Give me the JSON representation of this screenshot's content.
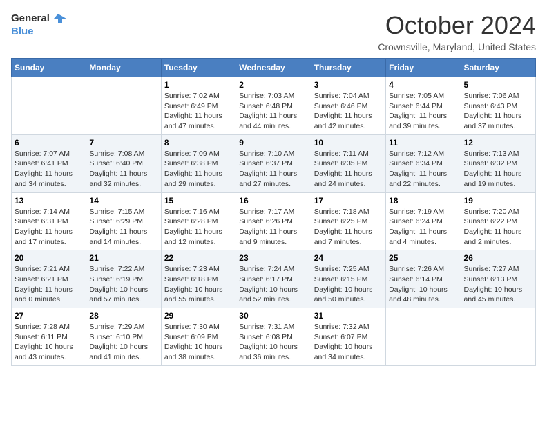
{
  "header": {
    "logo_line1": "General",
    "logo_line2": "Blue",
    "month_title": "October 2024",
    "location": "Crownsville, Maryland, United States"
  },
  "days_of_week": [
    "Sunday",
    "Monday",
    "Tuesday",
    "Wednesday",
    "Thursday",
    "Friday",
    "Saturday"
  ],
  "weeks": [
    [
      {
        "day": "",
        "sunrise": "",
        "sunset": "",
        "daylight": ""
      },
      {
        "day": "",
        "sunrise": "",
        "sunset": "",
        "daylight": ""
      },
      {
        "day": "1",
        "sunrise": "Sunrise: 7:02 AM",
        "sunset": "Sunset: 6:49 PM",
        "daylight": "Daylight: 11 hours and 47 minutes."
      },
      {
        "day": "2",
        "sunrise": "Sunrise: 7:03 AM",
        "sunset": "Sunset: 6:48 PM",
        "daylight": "Daylight: 11 hours and 44 minutes."
      },
      {
        "day": "3",
        "sunrise": "Sunrise: 7:04 AM",
        "sunset": "Sunset: 6:46 PM",
        "daylight": "Daylight: 11 hours and 42 minutes."
      },
      {
        "day": "4",
        "sunrise": "Sunrise: 7:05 AM",
        "sunset": "Sunset: 6:44 PM",
        "daylight": "Daylight: 11 hours and 39 minutes."
      },
      {
        "day": "5",
        "sunrise": "Sunrise: 7:06 AM",
        "sunset": "Sunset: 6:43 PM",
        "daylight": "Daylight: 11 hours and 37 minutes."
      }
    ],
    [
      {
        "day": "6",
        "sunrise": "Sunrise: 7:07 AM",
        "sunset": "Sunset: 6:41 PM",
        "daylight": "Daylight: 11 hours and 34 minutes."
      },
      {
        "day": "7",
        "sunrise": "Sunrise: 7:08 AM",
        "sunset": "Sunset: 6:40 PM",
        "daylight": "Daylight: 11 hours and 32 minutes."
      },
      {
        "day": "8",
        "sunrise": "Sunrise: 7:09 AM",
        "sunset": "Sunset: 6:38 PM",
        "daylight": "Daylight: 11 hours and 29 minutes."
      },
      {
        "day": "9",
        "sunrise": "Sunrise: 7:10 AM",
        "sunset": "Sunset: 6:37 PM",
        "daylight": "Daylight: 11 hours and 27 minutes."
      },
      {
        "day": "10",
        "sunrise": "Sunrise: 7:11 AM",
        "sunset": "Sunset: 6:35 PM",
        "daylight": "Daylight: 11 hours and 24 minutes."
      },
      {
        "day": "11",
        "sunrise": "Sunrise: 7:12 AM",
        "sunset": "Sunset: 6:34 PM",
        "daylight": "Daylight: 11 hours and 22 minutes."
      },
      {
        "day": "12",
        "sunrise": "Sunrise: 7:13 AM",
        "sunset": "Sunset: 6:32 PM",
        "daylight": "Daylight: 11 hours and 19 minutes."
      }
    ],
    [
      {
        "day": "13",
        "sunrise": "Sunrise: 7:14 AM",
        "sunset": "Sunset: 6:31 PM",
        "daylight": "Daylight: 11 hours and 17 minutes."
      },
      {
        "day": "14",
        "sunrise": "Sunrise: 7:15 AM",
        "sunset": "Sunset: 6:29 PM",
        "daylight": "Daylight: 11 hours and 14 minutes."
      },
      {
        "day": "15",
        "sunrise": "Sunrise: 7:16 AM",
        "sunset": "Sunset: 6:28 PM",
        "daylight": "Daylight: 11 hours and 12 minutes."
      },
      {
        "day": "16",
        "sunrise": "Sunrise: 7:17 AM",
        "sunset": "Sunset: 6:26 PM",
        "daylight": "Daylight: 11 hours and 9 minutes."
      },
      {
        "day": "17",
        "sunrise": "Sunrise: 7:18 AM",
        "sunset": "Sunset: 6:25 PM",
        "daylight": "Daylight: 11 hours and 7 minutes."
      },
      {
        "day": "18",
        "sunrise": "Sunrise: 7:19 AM",
        "sunset": "Sunset: 6:24 PM",
        "daylight": "Daylight: 11 hours and 4 minutes."
      },
      {
        "day": "19",
        "sunrise": "Sunrise: 7:20 AM",
        "sunset": "Sunset: 6:22 PM",
        "daylight": "Daylight: 11 hours and 2 minutes."
      }
    ],
    [
      {
        "day": "20",
        "sunrise": "Sunrise: 7:21 AM",
        "sunset": "Sunset: 6:21 PM",
        "daylight": "Daylight: 11 hours and 0 minutes."
      },
      {
        "day": "21",
        "sunrise": "Sunrise: 7:22 AM",
        "sunset": "Sunset: 6:19 PM",
        "daylight": "Daylight: 10 hours and 57 minutes."
      },
      {
        "day": "22",
        "sunrise": "Sunrise: 7:23 AM",
        "sunset": "Sunset: 6:18 PM",
        "daylight": "Daylight: 10 hours and 55 minutes."
      },
      {
        "day": "23",
        "sunrise": "Sunrise: 7:24 AM",
        "sunset": "Sunset: 6:17 PM",
        "daylight": "Daylight: 10 hours and 52 minutes."
      },
      {
        "day": "24",
        "sunrise": "Sunrise: 7:25 AM",
        "sunset": "Sunset: 6:15 PM",
        "daylight": "Daylight: 10 hours and 50 minutes."
      },
      {
        "day": "25",
        "sunrise": "Sunrise: 7:26 AM",
        "sunset": "Sunset: 6:14 PM",
        "daylight": "Daylight: 10 hours and 48 minutes."
      },
      {
        "day": "26",
        "sunrise": "Sunrise: 7:27 AM",
        "sunset": "Sunset: 6:13 PM",
        "daylight": "Daylight: 10 hours and 45 minutes."
      }
    ],
    [
      {
        "day": "27",
        "sunrise": "Sunrise: 7:28 AM",
        "sunset": "Sunset: 6:11 PM",
        "daylight": "Daylight: 10 hours and 43 minutes."
      },
      {
        "day": "28",
        "sunrise": "Sunrise: 7:29 AM",
        "sunset": "Sunset: 6:10 PM",
        "daylight": "Daylight: 10 hours and 41 minutes."
      },
      {
        "day": "29",
        "sunrise": "Sunrise: 7:30 AM",
        "sunset": "Sunset: 6:09 PM",
        "daylight": "Daylight: 10 hours and 38 minutes."
      },
      {
        "day": "30",
        "sunrise": "Sunrise: 7:31 AM",
        "sunset": "Sunset: 6:08 PM",
        "daylight": "Daylight: 10 hours and 36 minutes."
      },
      {
        "day": "31",
        "sunrise": "Sunrise: 7:32 AM",
        "sunset": "Sunset: 6:07 PM",
        "daylight": "Daylight: 10 hours and 34 minutes."
      },
      {
        "day": "",
        "sunrise": "",
        "sunset": "",
        "daylight": ""
      },
      {
        "day": "",
        "sunrise": "",
        "sunset": "",
        "daylight": ""
      }
    ]
  ]
}
